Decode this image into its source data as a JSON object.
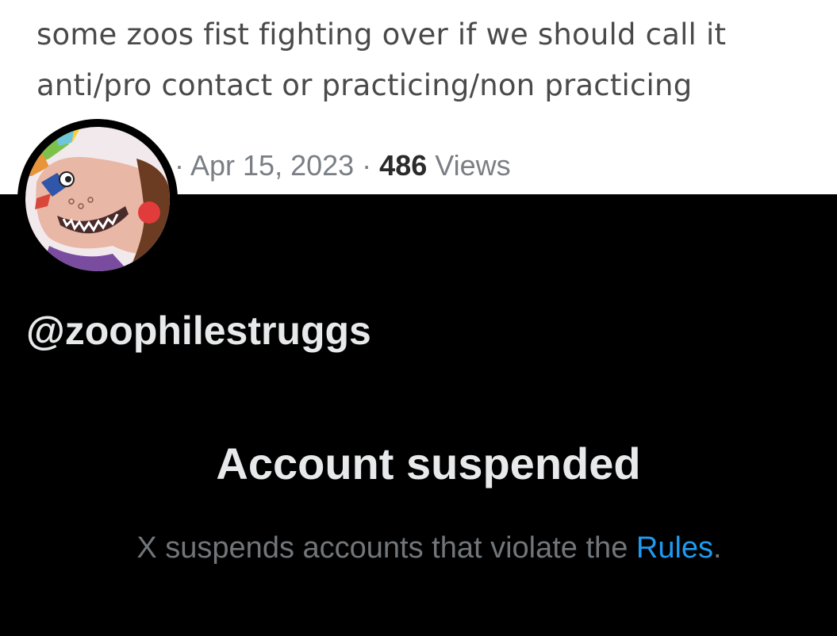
{
  "tweet": {
    "line1": "some zoos fist fighting over if we should call it",
    "line2": "anti/pro contact or practicing/non practicing",
    "separator1": "· ",
    "date": "Apr 15, 2023",
    "separator2": " · ",
    "views_count": "486",
    "views_label": " Views"
  },
  "profile": {
    "avatar_icon": "clown-hyena-avatar-icon",
    "handle": "@zoophilestruggs"
  },
  "suspension": {
    "title": "Account suspended",
    "message_prefix": "X suspends accounts that violate the ",
    "rules_link": "Rules",
    "message_suffix": "."
  },
  "colors": {
    "background": "#000000",
    "primary_text": "#e7e9ea",
    "secondary_text": "#71767b",
    "link": "#1d9bf0",
    "tweet_background": "#ffffff"
  }
}
